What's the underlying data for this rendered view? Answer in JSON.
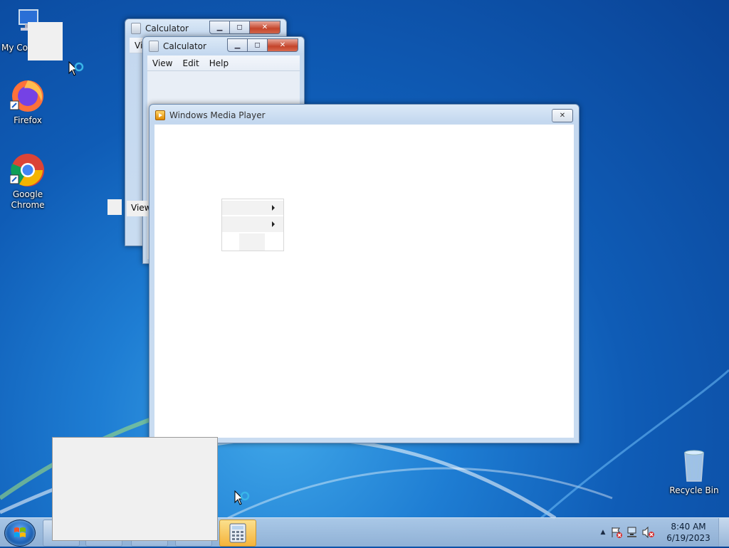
{
  "desktop": {
    "icons": [
      {
        "label": "My Computer"
      },
      {
        "label": "Firefox"
      },
      {
        "label": "Google\nChrome"
      },
      {
        "label": "Recycle Bin"
      }
    ],
    "partial_label": "My Co"
  },
  "windows": {
    "calculator_back": {
      "title": "Calculator",
      "menu_visible": "Vi"
    },
    "calculator_front": {
      "title": "Calculator",
      "menus": [
        "View",
        "Edit",
        "Help"
      ]
    },
    "media_player": {
      "title": "Windows Media Player"
    }
  },
  "context_menu": {
    "label": "View"
  },
  "taskbar": {
    "time": "8:40 AM",
    "date": "6/19/2023"
  },
  "colors": {
    "accent": "#1e7dd3",
    "close_button": "#c4442a",
    "active_task": "#f4b33a"
  }
}
